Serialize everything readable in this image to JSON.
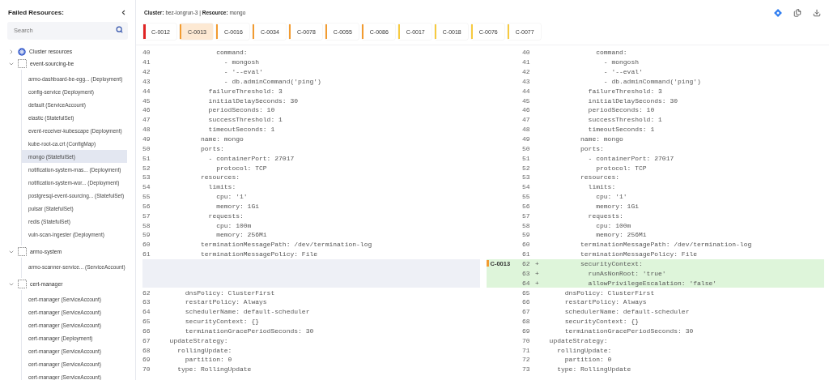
{
  "sidebar": {
    "title": "Failed Resources:",
    "search": {
      "placeholder": "Search"
    },
    "tree": [
      {
        "label": "Cluster resources",
        "kind": "cluster",
        "expanded": false
      },
      {
        "label": "event-sourcing-be",
        "kind": "namespace",
        "expanded": true,
        "children": [
          {
            "label": "armo-dashboard-be-egg...  (Deployment)",
            "selected": false
          },
          {
            "label": "config-service (Deployment)",
            "selected": false
          },
          {
            "label": "default (ServiceAccount)",
            "selected": false
          },
          {
            "label": "elastic (StatefulSet)",
            "selected": false
          },
          {
            "label": "event-receiver-kubescape (Deployment)",
            "selected": false
          },
          {
            "label": "kube-root-ca.crt (ConfigMap)",
            "selected": false
          },
          {
            "label": "mongo (StatefulSet)",
            "selected": true
          },
          {
            "label": "notification-system-mas...  (Deployment)",
            "selected": false
          },
          {
            "label": "notification-system-wor...  (Deployment)",
            "selected": false
          },
          {
            "label": "postgresql-event-sourcing... (StatefulSet)",
            "selected": false
          },
          {
            "label": "pulsar (StatefulSet)",
            "selected": false
          },
          {
            "label": "redis (StatefulSet)",
            "selected": false
          },
          {
            "label": "vuln-scan-ingester (Deployment)",
            "selected": false
          }
        ]
      },
      {
        "label": "armo-system",
        "kind": "namespace",
        "expanded": true,
        "children": [
          {
            "label": "armo-scanner-service... (ServiceAccount)",
            "selected": false
          }
        ]
      },
      {
        "label": "cert-manager",
        "kind": "namespace",
        "expanded": true,
        "children": [
          {
            "label": "cert-manager (ServiceAccount)",
            "selected": false
          },
          {
            "label": "cert-manager (ServiceAccount)",
            "selected": false
          },
          {
            "label": "cert-manager (ServiceAccount)",
            "selected": false
          },
          {
            "label": "cert-manager (Deployment)",
            "selected": false
          },
          {
            "label": "cert-manager (ServiceAccount)",
            "selected": false
          },
          {
            "label": "cert-manager (ServiceAccount)",
            "selected": false
          },
          {
            "label": "cert-manager (ServiceAccount)",
            "selected": false
          }
        ]
      }
    ]
  },
  "header": {
    "cluster_label": "Cluster:",
    "cluster": "bez-longrun-3",
    "separator": "|",
    "resource_label": "Resource:",
    "resource": "mongo"
  },
  "controls": [
    {
      "label": "C-0012",
      "color": "#e02424",
      "selected": false
    },
    {
      "label": "C-0013",
      "color": "#f29b30",
      "selected": true
    },
    {
      "label": "C-0016",
      "color": "#f29b30",
      "selected": false
    },
    {
      "label": "C-0034",
      "color": "#f29b30",
      "selected": false
    },
    {
      "label": "C-0078",
      "color": "#f29b30",
      "selected": false
    },
    {
      "label": "C-0055",
      "color": "#f29b30",
      "selected": false
    },
    {
      "label": "C-0086",
      "color": "#f29b30",
      "selected": false
    },
    {
      "label": "C-0017",
      "color": "#f7ca3e",
      "selected": false
    },
    {
      "label": "C-0018",
      "color": "#f7ca3e",
      "selected": false
    },
    {
      "label": "C-0076",
      "color": "#f7ca3e",
      "selected": false
    },
    {
      "label": "C-0077",
      "color": "#f7ca3e",
      "selected": false
    }
  ],
  "panes": [
    {
      "lines": [
        {
          "kind": "normal",
          "number": "40",
          "text": "              command:"
        },
        {
          "kind": "normal",
          "number": "41",
          "text": "                - mongosh"
        },
        {
          "kind": "normal",
          "number": "42",
          "text": "                - '--eval'"
        },
        {
          "kind": "normal",
          "number": "43",
          "text": "                - db.adminCommand('ping')"
        },
        {
          "kind": "normal",
          "number": "44",
          "text": "            failureThreshold: 3"
        },
        {
          "kind": "normal",
          "number": "45",
          "text": "            initialDelaySeconds: 30"
        },
        {
          "kind": "normal",
          "number": "46",
          "text": "            periodSeconds: 10"
        },
        {
          "kind": "normal",
          "number": "47",
          "text": "            successThreshold: 1"
        },
        {
          "kind": "normal",
          "number": "48",
          "text": "            timeoutSeconds: 1"
        },
        {
          "kind": "normal",
          "number": "49",
          "text": "          name: mongo"
        },
        {
          "kind": "normal",
          "number": "50",
          "text": "          ports:"
        },
        {
          "kind": "normal",
          "number": "51",
          "text": "            - containerPort: 27017"
        },
        {
          "kind": "normal",
          "number": "52",
          "text": "              protocol: TCP"
        },
        {
          "kind": "normal",
          "number": "53",
          "text": "          resources:"
        },
        {
          "kind": "normal",
          "number": "54",
          "text": "            limits:"
        },
        {
          "kind": "normal",
          "number": "55",
          "text": "              cpu: '1'"
        },
        {
          "kind": "normal",
          "number": "56",
          "text": "              memory: 1Gi"
        },
        {
          "kind": "normal",
          "number": "57",
          "text": "            requests:"
        },
        {
          "kind": "normal",
          "number": "58",
          "text": "              cpu: 100m"
        },
        {
          "kind": "normal",
          "number": "59",
          "text": "              memory: 256Mi"
        },
        {
          "kind": "normal",
          "number": "60",
          "text": "          terminationMessagePath: /dev/termination-log"
        },
        {
          "kind": "normal",
          "number": "61",
          "text": "          terminationMessagePolicy: File"
        },
        {
          "kind": "blank"
        },
        {
          "kind": "blank"
        },
        {
          "kind": "blank"
        },
        {
          "kind": "normal",
          "number": "62",
          "text": "      dnsPolicy: ClusterFirst"
        },
        {
          "kind": "normal",
          "number": "63",
          "text": "      restartPolicy: Always"
        },
        {
          "kind": "normal",
          "number": "64",
          "text": "      schedulerName: default-scheduler"
        },
        {
          "kind": "normal",
          "number": "65",
          "text": "      securityContext: {}"
        },
        {
          "kind": "normal",
          "number": "66",
          "text": "      terminationGracePeriodSeconds: 30"
        },
        {
          "kind": "normal",
          "number": "67",
          "text": "  updateStrategy:"
        },
        {
          "kind": "normal",
          "number": "68",
          "text": "    rollingUpdate:"
        },
        {
          "kind": "normal",
          "number": "69",
          "text": "      partition: 0"
        },
        {
          "kind": "normal",
          "number": "70",
          "text": "    type: RollingUpdate"
        }
      ]
    },
    {
      "lines": [
        {
          "kind": "normal",
          "number": "40",
          "text": "              command:"
        },
        {
          "kind": "normal",
          "number": "41",
          "text": "                - mongosh"
        },
        {
          "kind": "normal",
          "number": "42",
          "text": "                - '--eval'"
        },
        {
          "kind": "normal",
          "number": "43",
          "text": "                - db.adminCommand('ping')"
        },
        {
          "kind": "normal",
          "number": "44",
          "text": "            failureThreshold: 3"
        },
        {
          "kind": "normal",
          "number": "45",
          "text": "            initialDelaySeconds: 30"
        },
        {
          "kind": "normal",
          "number": "46",
          "text": "            periodSeconds: 10"
        },
        {
          "kind": "normal",
          "number": "47",
          "text": "            successThreshold: 1"
        },
        {
          "kind": "normal",
          "number": "48",
          "text": "            timeoutSeconds: 1"
        },
        {
          "kind": "normal",
          "number": "49",
          "text": "          name: mongo"
        },
        {
          "kind": "normal",
          "number": "50",
          "text": "          ports:"
        },
        {
          "kind": "normal",
          "number": "51",
          "text": "            - containerPort: 27017"
        },
        {
          "kind": "normal",
          "number": "52",
          "text": "              protocol: TCP"
        },
        {
          "kind": "normal",
          "number": "53",
          "text": "          resources:"
        },
        {
          "kind": "normal",
          "number": "54",
          "text": "            limits:"
        },
        {
          "kind": "normal",
          "number": "55",
          "text": "              cpu: '1'"
        },
        {
          "kind": "normal",
          "number": "56",
          "text": "              memory: 1Gi"
        },
        {
          "kind": "normal",
          "number": "57",
          "text": "            requests:"
        },
        {
          "kind": "normal",
          "number": "58",
          "text": "              cpu: 100m"
        },
        {
          "kind": "normal",
          "number": "59",
          "text": "              memory: 256Mi"
        },
        {
          "kind": "normal",
          "number": "60",
          "text": "          terminationMessagePath: /dev/termination-log"
        },
        {
          "kind": "normal",
          "number": "61",
          "text": "          terminationMessagePolicy: File"
        },
        {
          "kind": "added",
          "number": "62",
          "sign": "+",
          "text": "          securityContext:",
          "marker": {
            "label": "C-0013",
            "color": "#f29b30"
          }
        },
        {
          "kind": "added",
          "number": "63",
          "sign": "+",
          "text": "            runAsNonRoot: 'true'"
        },
        {
          "kind": "added",
          "number": "64",
          "sign": "+",
          "text": "            allowPrivilegeEscalation: 'false'"
        },
        {
          "kind": "normal",
          "number": "65",
          "text": "      dnsPolicy: ClusterFirst"
        },
        {
          "kind": "normal",
          "number": "66",
          "text": "      restartPolicy: Always"
        },
        {
          "kind": "normal",
          "number": "67",
          "text": "      schedulerName: default-scheduler"
        },
        {
          "kind": "normal",
          "number": "68",
          "text": "      securityContext: {}"
        },
        {
          "kind": "normal",
          "number": "69",
          "text": "      terminationGracePeriodSeconds: 30"
        },
        {
          "kind": "normal",
          "number": "70",
          "text": "  updateStrategy:"
        },
        {
          "kind": "normal",
          "number": "71",
          "text": "    rollingUpdate:"
        },
        {
          "kind": "normal",
          "number": "72",
          "text": "      partition: 0"
        },
        {
          "kind": "normal",
          "number": "73",
          "text": "    type: RollingUpdate"
        }
      ]
    }
  ]
}
